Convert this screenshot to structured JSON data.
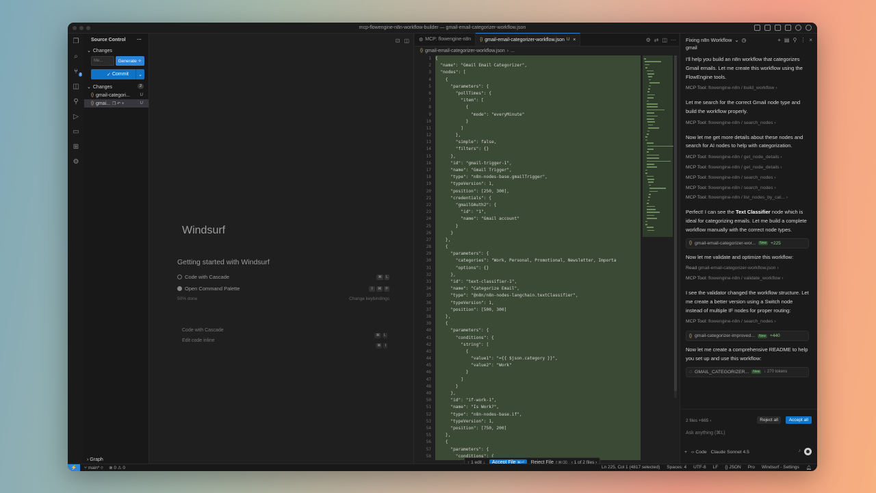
{
  "window": {
    "title": "mcp-flowengine-n8n-workflow-builder — gmail-email-categorizer-workflow.json"
  },
  "sidebar": {
    "title": "Source Control",
    "section": "Changes",
    "message_placeholder": "Me...",
    "generate_label": "Generate",
    "commit_label": "Commit",
    "changes_label": "Changes",
    "changes_count": "2",
    "files": [
      {
        "name": "gmail-categori...",
        "status": "U"
      },
      {
        "name": "gmai...",
        "status": "U"
      }
    ],
    "graph_label": "Graph"
  },
  "welcome": {
    "brand": "Windsurf",
    "getting_started": "Getting started with Windsurf",
    "items": [
      {
        "label": "Code with Cascade",
        "keys": [
          "⌘",
          "L"
        ],
        "done": false
      },
      {
        "label": "Open Command Palette",
        "keys": [
          "⇧",
          "⌘",
          "P"
        ],
        "done": true
      }
    ],
    "progress": "50% done",
    "change_keybindings": "Change keybindings",
    "shortcuts": [
      {
        "label": "Code with Cascade",
        "keys": [
          "⌘",
          "L"
        ]
      },
      {
        "label": "Edit code inline",
        "keys": [
          "⌘",
          "I"
        ]
      }
    ]
  },
  "editor": {
    "tabs": [
      {
        "label": "MCP: flowengine-n8n",
        "active": false,
        "mod": ""
      },
      {
        "label": "gmail-email-categorizer-workflow.json",
        "active": true,
        "mod": "U"
      }
    ],
    "breadcrumb": [
      "gmail-email-categorizer-workflow.json",
      "..."
    ],
    "line_numbers": [
      "1",
      "2",
      "3",
      "4",
      "5",
      "6",
      "7",
      "8",
      "9",
      "10",
      "11",
      "12",
      "13",
      "14",
      "15",
      "16",
      "17",
      "18",
      "19",
      "20",
      "21",
      "22",
      "23",
      "24",
      "25",
      "26",
      "27",
      "28",
      "29",
      "30",
      "31",
      "32",
      "33",
      "34",
      "35",
      "36",
      "37",
      "38",
      "39",
      "40",
      "41",
      "42",
      "43",
      "44",
      "45",
      "46",
      "47",
      "48",
      "49",
      "50",
      "51",
      "52",
      "53",
      "54",
      "55",
      "56",
      "57",
      "58"
    ],
    "code_lines": [
      "{",
      "  \"name\": \"Gmail Email Categorizer\",",
      "  \"nodes\": [",
      "    {",
      "      \"parameters\": {",
      "        \"pollTimes\": {",
      "          \"item\": [",
      "            {",
      "              \"mode\": \"everyMinute\"",
      "            }",
      "          ]",
      "        },",
      "        \"simple\": false,",
      "        \"filters\": {}",
      "      },",
      "      \"id\": \"gmail-trigger-1\",",
      "      \"name\": \"Gmail Trigger\",",
      "      \"type\": \"n8n-nodes-base.gmailTrigger\",",
      "      \"typeVersion\": 1,",
      "      \"position\": [250, 300],",
      "      \"credentials\": {",
      "        \"gmailOAuth2\": {",
      "          \"id\": \"1\",",
      "          \"name\": \"Gmail account\"",
      "        }",
      "      }",
      "    },",
      "    {",
      "      \"parameters\": {",
      "        \"categories\": \"Work, Personal, Promotional, Newsletter, Importa",
      "        \"options\": {}",
      "      },",
      "      \"id\": \"text-classifier-1\",",
      "      \"name\": \"Categorize Email\",",
      "      \"type\": \"@n8n/n8n-nodes-langchain.textClassifier\",",
      "      \"typeVersion\": 1,",
      "      \"position\": [500, 300]",
      "    },",
      "    {",
      "      \"parameters\": {",
      "        \"conditions\": {",
      "          \"string\": [",
      "            {",
      "              \"value1\": \"={{ $json.category }}\",",
      "              \"value2\": \"Work\"",
      "            }",
      "          ]",
      "        }",
      "      },",
      "      \"id\": \"if-work-1\",",
      "      \"name\": \"Is Work?\",",
      "      \"type\": \"n8n-nodes-base.if\",",
      "      \"typeVersion\": 1,",
      "      \"position\": [750, 200]",
      "    },",
      "    {",
      "      \"parameters\": {",
      "        \"conditions\": {"
    ],
    "accept_bar": {
      "edit_nav": "1 edit",
      "accept_file": "Accept File",
      "accept_kbd": "⌘⏎",
      "reject_file": "Reject File",
      "reject_kbd": "⇧⌘⌫",
      "files_nav": "1 of 2 files"
    }
  },
  "chat": {
    "title": "Fixing n8n Workflow",
    "query": "gmail",
    "messages": [
      {
        "type": "text",
        "text": "I'll help you build an n8n workflow that categorizes Gmail emails. Let me create this workflow using the FlowEngine tools."
      },
      {
        "type": "tool",
        "label": "MCP Tool:",
        "value": "flowengine-n8n / build_workflow"
      },
      {
        "type": "text",
        "text": "Let me search for the correct Gmail node type and build the workflow properly."
      },
      {
        "type": "tool",
        "label": "MCP Tool:",
        "value": "flowengine-n8n / search_nodes"
      },
      {
        "type": "text",
        "text": "Now let me get more details about these nodes and search for AI nodes to help with categorization."
      },
      {
        "type": "tool",
        "label": "MCP Tool:",
        "value": "flowengine-n8n / get_node_details"
      },
      {
        "type": "tool",
        "label": "MCP Tool:",
        "value": "flowengine-n8n / get_node_details"
      },
      {
        "type": "tool",
        "label": "MCP Tool:",
        "value": "flowengine-n8n / search_nodes"
      },
      {
        "type": "tool",
        "label": "MCP Tool:",
        "value": "flowengine-n8n / search_nodes"
      },
      {
        "type": "tool",
        "label": "MCP Tool:",
        "value": "flowengine-n8n / list_nodes_by_cat..."
      },
      {
        "type": "text_bold",
        "pre": "Perfect! I can see the ",
        "bold": "Text Classifier",
        "post": " node which is ideal for categorizing emails. Let me build a complete workflow manually with the correct node types."
      },
      {
        "type": "file",
        "name": "gmail-email-categorizer-wor...",
        "tag": "New",
        "delta": "+225"
      },
      {
        "type": "text",
        "text": "Now let me validate and optimize this workflow:"
      },
      {
        "type": "tool",
        "label": "Read",
        "value": "gmail-email-categorizer-workflow.json"
      },
      {
        "type": "tool",
        "label": "MCP Tool:",
        "value": "flowengine-n8n / validate_workflow"
      },
      {
        "type": "text",
        "text": "I see the validator changed the workflow structure. Let me create a better version using a Switch node instead of multiple IF nodes for proper routing:"
      },
      {
        "type": "tool",
        "label": "MCP Tool:",
        "value": "flowengine-n8n / search_nodes"
      },
      {
        "type": "file",
        "name": "gmail-categorizer-improved...",
        "tag": "New",
        "delta": "+440"
      },
      {
        "type": "text",
        "text": "Now let me create a comprehensive README to help you set up and use this workflow:"
      },
      {
        "type": "file_pending",
        "name": "GMAIL_CATEGORIZER...",
        "tag": "New",
        "delta": "↓ 270 tokens"
      }
    ],
    "footer": {
      "files_summary": "2 files +665",
      "reject_all": "Reject all",
      "accept_all": "Accept all",
      "placeholder": "Ask anything (⌘L)",
      "mode": "Code",
      "model": "Claude Sonnet 4.5"
    }
  },
  "status": {
    "branch": "main*",
    "problems": "0 ⚠ 0",
    "cursor": "Ln 225, Col 1 (4817 selected)",
    "spaces": "Spaces: 4",
    "encoding": "UTF-8",
    "eol": "LF",
    "language": "JSON",
    "plan": "Pro",
    "settings": "Windsurf - Settings"
  },
  "colors": {
    "accent": "#0f73c7",
    "diff_added_bg": "#3b4a34"
  }
}
